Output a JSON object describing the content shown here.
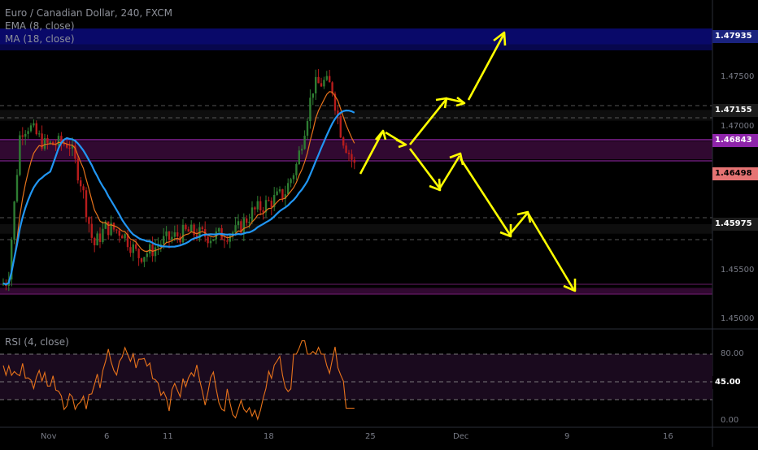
{
  "header": {
    "symbol_line": "Euro / Canadian Dollar, 240, FXCM",
    "ema_label": "EMA (8, close)",
    "ma_label": "MA (18, close)",
    "rsi_label": "RSI (4, close)"
  },
  "colors": {
    "background": "#000000",
    "up_candle": "#2e7d32",
    "down_candle": "#b71c1c",
    "ema": "#2196f3",
    "ma": "#e8731b",
    "rsi": "#e8731b",
    "arrows": "#ffff00",
    "zone_blue": "#0a0a6e",
    "zone_purple": "#3a0a3a",
    "zone_magenta_line": "#9c27b0"
  },
  "price_tags": [
    {
      "value": "1.47935",
      "bg": "#1a237e",
      "fg": "#ffffff"
    },
    {
      "value": "1.47155",
      "bg": "#1c1c1c",
      "fg": "#ffffff"
    },
    {
      "value": "1.46843",
      "bg": "#8e24aa",
      "fg": "#ffffff"
    },
    {
      "value": "1.46498",
      "bg": "#e57373",
      "fg": "#000000"
    },
    {
      "value": "1.45975",
      "bg": "#1c1c1c",
      "fg": "#ffffff"
    },
    {
      "value": "45.00",
      "bg": "#000000",
      "fg": "#ffffff"
    }
  ],
  "price_axis": [
    "1.47500",
    "1.47000",
    "1.45500",
    "1.45000"
  ],
  "rsi_axis": [
    "80.00",
    "0.00"
  ],
  "time_axis": [
    "Nov",
    "6",
    "11",
    "18",
    "25",
    "Dec",
    "9",
    "16"
  ],
  "chart_data": {
    "type": "candlestick",
    "title": "Euro / Canadian Dollar, 240, FXCM",
    "ylim": [
      1.449,
      1.482
    ],
    "rsi_ylim": [
      0,
      100
    ],
    "rsi_levels": [
      80,
      45,
      20
    ],
    "zones": [
      {
        "from": 1.4784,
        "to": 1.48,
        "color": "blue"
      },
      {
        "from": 1.4705,
        "to": 1.4716,
        "color": "grey"
      },
      {
        "from": 1.4665,
        "to": 1.4684,
        "color": "purple"
      },
      {
        "from": 1.4588,
        "to": 1.4598,
        "color": "grey"
      },
      {
        "from": 1.4525,
        "to": 1.4532,
        "color": "purple"
      }
    ],
    "last_close": 1.46498
  }
}
